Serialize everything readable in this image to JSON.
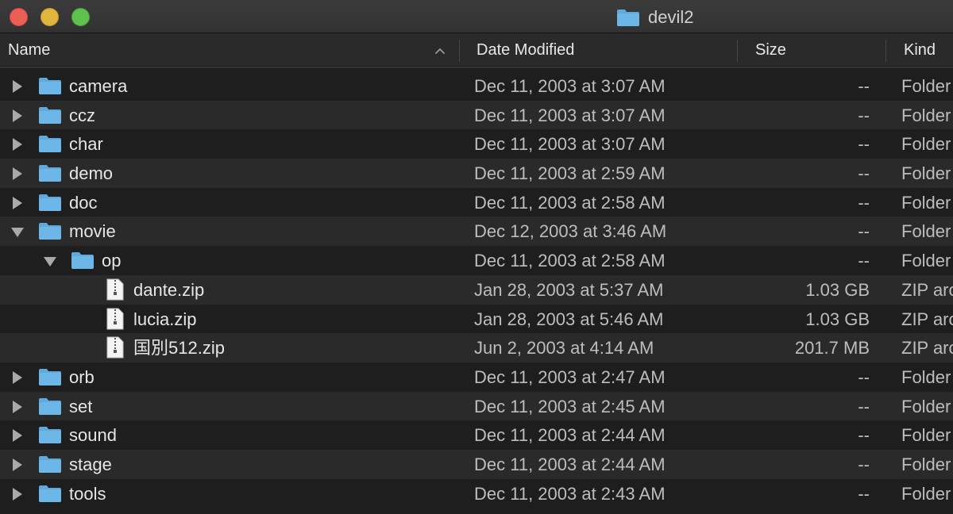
{
  "window": {
    "title": "devil2",
    "title_icon": "folder-icon"
  },
  "columns": {
    "name": "Name",
    "date_modified": "Date Modified",
    "size": "Size",
    "kind": "Kind",
    "sort_icon": "chevron-up-icon"
  },
  "colors": {
    "folder": "#5fa9dd",
    "close": "#ec5f57",
    "minimize": "#e0b53d",
    "zoom": "#5fc14e"
  },
  "rows": [
    {
      "name": "camera",
      "date": "Dec 11, 2003 at 3:07 AM",
      "size": "--",
      "kind": "Folder",
      "type": "folder",
      "depth": 0,
      "expanded": false
    },
    {
      "name": "ccz",
      "date": "Dec 11, 2003 at 3:07 AM",
      "size": "--",
      "kind": "Folder",
      "type": "folder",
      "depth": 0,
      "expanded": false
    },
    {
      "name": "char",
      "date": "Dec 11, 2003 at 3:07 AM",
      "size": "--",
      "kind": "Folder",
      "type": "folder",
      "depth": 0,
      "expanded": false
    },
    {
      "name": "demo",
      "date": "Dec 11, 2003 at 2:59 AM",
      "size": "--",
      "kind": "Folder",
      "type": "folder",
      "depth": 0,
      "expanded": false
    },
    {
      "name": "doc",
      "date": "Dec 11, 2003 at 2:58 AM",
      "size": "--",
      "kind": "Folder",
      "type": "folder",
      "depth": 0,
      "expanded": false
    },
    {
      "name": "movie",
      "date": "Dec 12, 2003 at 3:46 AM",
      "size": "--",
      "kind": "Folder",
      "type": "folder",
      "depth": 0,
      "expanded": true
    },
    {
      "name": "op",
      "date": "Dec 11, 2003 at 2:58 AM",
      "size": "--",
      "kind": "Folder",
      "type": "folder",
      "depth": 1,
      "expanded": true
    },
    {
      "name": "dante.zip",
      "date": "Jan 28, 2003 at 5:37 AM",
      "size": "1.03 GB",
      "kind": "ZIP arc",
      "type": "zip",
      "depth": 2,
      "expanded": false
    },
    {
      "name": "lucia.zip",
      "date": "Jan 28, 2003 at 5:46 AM",
      "size": "1.03 GB",
      "kind": "ZIP arc",
      "type": "zip",
      "depth": 2,
      "expanded": false
    },
    {
      "name": "国別512.zip",
      "date": "Jun 2, 2003 at 4:14 AM",
      "size": "201.7 MB",
      "kind": "ZIP arc",
      "type": "zip",
      "depth": 2,
      "expanded": false
    },
    {
      "name": "orb",
      "date": "Dec 11, 2003 at 2:47 AM",
      "size": "--",
      "kind": "Folder",
      "type": "folder",
      "depth": 0,
      "expanded": false
    },
    {
      "name": "set",
      "date": "Dec 11, 2003 at 2:45 AM",
      "size": "--",
      "kind": "Folder",
      "type": "folder",
      "depth": 0,
      "expanded": false
    },
    {
      "name": "sound",
      "date": "Dec 11, 2003 at 2:44 AM",
      "size": "--",
      "kind": "Folder",
      "type": "folder",
      "depth": 0,
      "expanded": false
    },
    {
      "name": "stage",
      "date": "Dec 11, 2003 at 2:44 AM",
      "size": "--",
      "kind": "Folder",
      "type": "folder",
      "depth": 0,
      "expanded": false
    },
    {
      "name": "tools",
      "date": "Dec 11, 2003 at 2:43 AM",
      "size": "--",
      "kind": "Folder",
      "type": "folder",
      "depth": 0,
      "expanded": false
    }
  ]
}
